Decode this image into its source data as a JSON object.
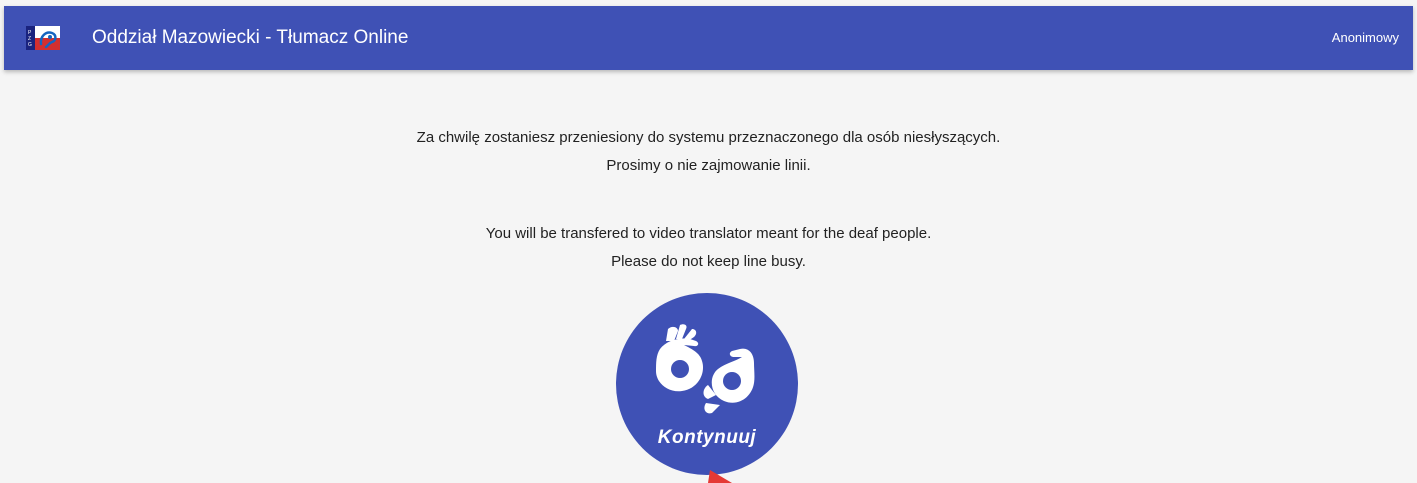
{
  "header": {
    "logo_icon": "sign-language-logo-icon",
    "title": "Oddział Mazowiecki - Tłumacz Online",
    "user": "Anonimowy",
    "bar_color": "#3f51b5"
  },
  "messages": {
    "pl_line1": "Za chwilę zostaniesz przeniesiony do systemu przeznaczonego dla osób niesłyszących.",
    "pl_line2": "Prosimy o nie zajmowanie linii.",
    "en_line1": "You will be transfered to video translator meant for the deaf people.",
    "en_line2": "Please do not keep line busy."
  },
  "continue_button": {
    "label": "Kontynuuj",
    "icon": "sign-language-hands-icon",
    "color": "#3f51b5"
  },
  "cursor_icon": "red-arrow-cursor-icon"
}
